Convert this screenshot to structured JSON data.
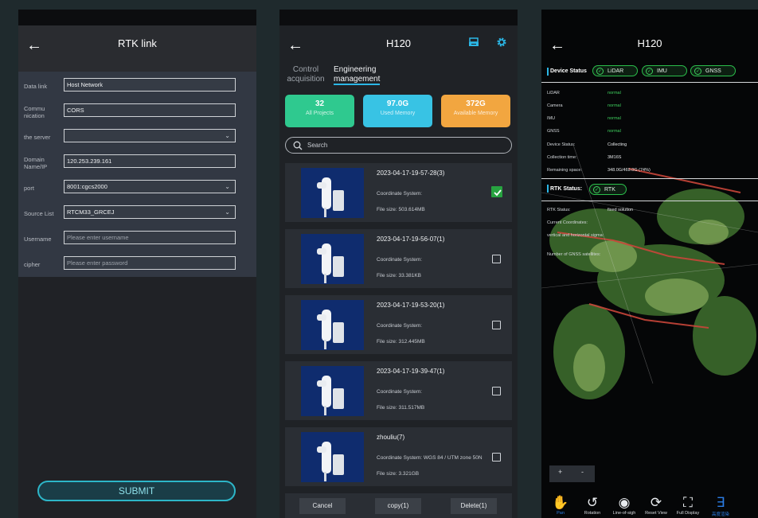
{
  "rtk_link": {
    "title": "RTK link",
    "fields": [
      {
        "label": "Data link",
        "value": "Host Network",
        "placeholder": "",
        "dropdown": false
      },
      {
        "label": "Commu nication",
        "value": "CORS",
        "placeholder": "",
        "dropdown": false
      },
      {
        "label": "the server",
        "value": "",
        "placeholder": "",
        "dropdown": true
      },
      {
        "label": "Domain Name/IP",
        "value": "120.253.239.161",
        "placeholder": "",
        "dropdown": false
      },
      {
        "label": "port",
        "value": "8001:cgcs2000",
        "placeholder": "",
        "dropdown": true
      },
      {
        "label": "Source List",
        "value": "RTCM33_GRCEJ",
        "placeholder": "",
        "dropdown": true
      },
      {
        "label": "Username",
        "value": "",
        "placeholder": "Please enter username",
        "dropdown": false
      },
      {
        "label": "cipher",
        "value": "",
        "placeholder": "Please enter password",
        "dropdown": false
      }
    ],
    "submit_label": "SUBMIT"
  },
  "engineering": {
    "title": "H120",
    "tabs": [
      "Control acquisition",
      "Engineering management"
    ],
    "active_tab": 1,
    "cards": [
      {
        "value": "32",
        "label": "All Projects",
        "color": "#2fc98f"
      },
      {
        "value": "97.0G",
        "label": "Used Memory",
        "color": "#38c3e4"
      },
      {
        "value": "372G",
        "label": "Available Memory",
        "color": "#f2a640"
      }
    ],
    "search_placeholder": "Search",
    "coord_label": "Coordinate System:",
    "size_label": "File size:",
    "projects": [
      {
        "name": "2023-04-17-19-57-28(3)",
        "coord": "",
        "size": "503.614MB",
        "checked": true
      },
      {
        "name": "2023-04-17-19-56-07(1)",
        "coord": "",
        "size": "33.381KB",
        "checked": false
      },
      {
        "name": "2023-04-17-19-53-20(1)",
        "coord": "",
        "size": "312.445MB",
        "checked": false
      },
      {
        "name": "2023-04-17-19-39-47(1)",
        "coord": "",
        "size": "311.517MB",
        "checked": false
      },
      {
        "name": "zhouliu(7)",
        "coord": "WGS 84 / UTM zone 50N",
        "size": "3.321GB",
        "checked": false
      }
    ],
    "actions": [
      "Cancel",
      "copy(1)",
      "Delete(1)"
    ]
  },
  "device": {
    "title": "H120",
    "section_label": "Device Status",
    "chips": [
      "LiDAR",
      "IMU",
      "GNSS"
    ],
    "rows": [
      {
        "label": "LiDAR",
        "value": "normal",
        "status": "green"
      },
      {
        "label": "Camera",
        "value": "normal",
        "status": "green"
      },
      {
        "label": "IMU",
        "value": "normal",
        "status": "green"
      },
      {
        "label": "GNSS",
        "value": "normal",
        "status": "green"
      },
      {
        "label": "Device Status:",
        "value": "Collecting",
        "status": "white"
      },
      {
        "label": "Collection time:",
        "value": "3M16S",
        "status": "white"
      },
      {
        "label": "Remaining space:",
        "value": "348.0G/469.0G (74%)",
        "status": "white"
      }
    ],
    "rtk_label": "RTK Status:",
    "rtk_chip": "RTK",
    "rtk_rows": [
      {
        "label": "RTK Status:",
        "value": "fixed solution"
      },
      {
        "label": "Current Coordinates:",
        "value": ""
      },
      {
        "label": "vertical and horizontal sigma:",
        "value": ""
      },
      {
        "label": "Number of GNSS satellites:",
        "value": ""
      }
    ],
    "zoom": [
      "+",
      "-"
    ],
    "tools": [
      "Pan",
      "Rotation",
      "Line-of-sigh",
      "Reset View",
      "Full Display",
      "高度渲染"
    ],
    "colors": {
      "accent": "#2bb7e6",
      "ok": "#3fd05e"
    }
  }
}
